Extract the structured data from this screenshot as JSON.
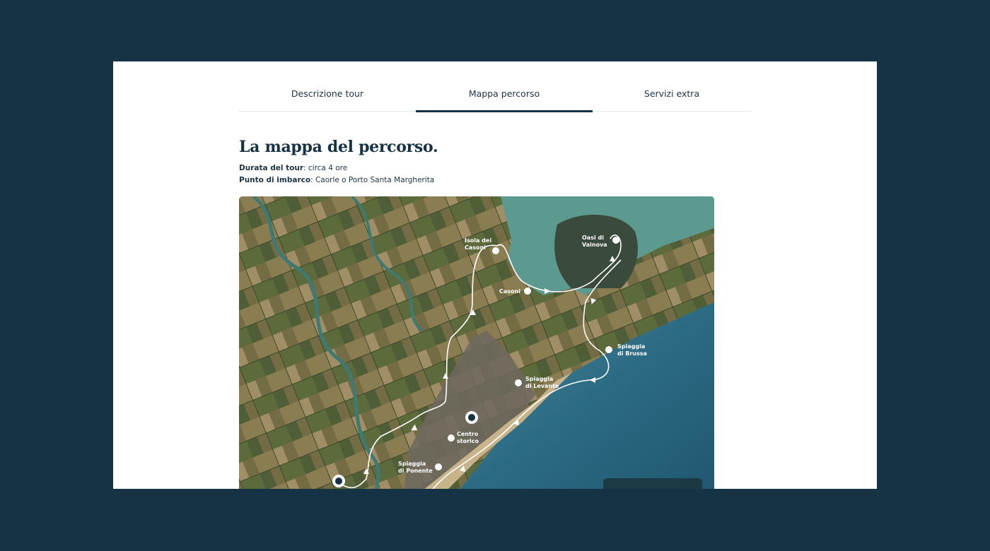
{
  "tabs": [
    {
      "label": "Descrizione tour"
    },
    {
      "label": "Mappa percorso"
    },
    {
      "label": "Servizi extra"
    }
  ],
  "heading": "La mappa del percorso.",
  "details": {
    "duration_label": "Durata del tour",
    "duration_value": ": circa 4 ore",
    "boarding_label": "Punto di imbarco",
    "boarding_value": ": Caorle o Porto Santa Margherita"
  },
  "map": {
    "places": {
      "isola_casoni": [
        "Isola dei",
        "Casoni"
      ],
      "oasi_valnova": [
        "Oasi di",
        "Valnova"
      ],
      "casoni": [
        "Casoni"
      ],
      "spiaggia_brussa": [
        "Spiaggia",
        "di Brussa"
      ],
      "spiaggia_levante": [
        "Spiaggia",
        "di Levante"
      ],
      "centro_storico": [
        "Centro",
        "storico"
      ],
      "spiaggia_ponente": [
        "Spiaggia",
        "di Ponente"
      ]
    },
    "colors": {
      "route": "#ffffff",
      "sea": "#2f6f86",
      "lagoon": "#5c9a8f",
      "land": "#6b6a3e"
    }
  }
}
